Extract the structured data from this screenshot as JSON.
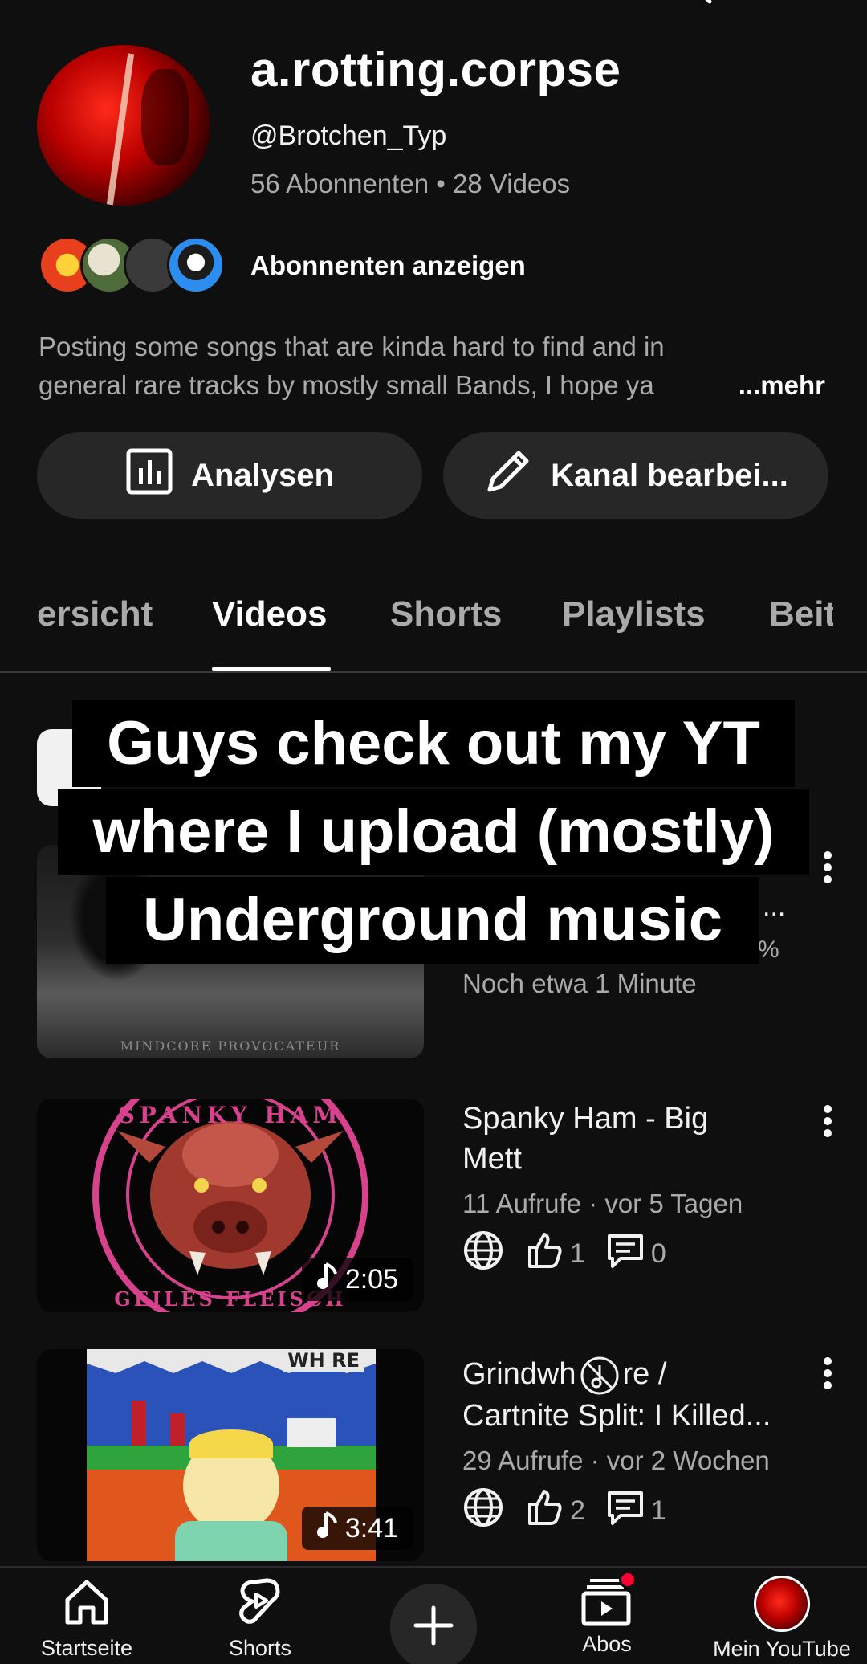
{
  "channel": {
    "name": "a.rotting.corpse",
    "handle": "@Brotchen_Typ",
    "meta": "56 Abonnenten • 28 Videos",
    "subscribers_link": "Abonnenten anzeigen",
    "description_line1": "Posting some songs that are kinda hard to find and in",
    "description_line2": "general rare tracks by mostly small Bands, I hope ya",
    "more_label": "...mehr"
  },
  "buttons": {
    "analytics": "Analysen",
    "edit_channel": "Kanal bearbei..."
  },
  "tabs": [
    "ersicht",
    "Videos",
    "Shorts",
    "Playlists",
    "Beit"
  ],
  "caption": {
    "line1": "Guys check out my YT",
    "line2": "where I upload (mostly)",
    "line3": "Underground music"
  },
  "videos": [
    {
      "thumb_text": "MINDCORE PROVOCATEUR",
      "title_partial": "...",
      "meta": "Noch etwa 1 Minute",
      "percent": "%"
    },
    {
      "title": "Spanky Ham - Big Mett",
      "title_line1": "Spanky Ham - Big",
      "title_line2": "Mett",
      "meta": "11 Aufrufe · vor 5 Tagen",
      "likes": "1",
      "comments": "0",
      "duration": "2:05",
      "thumb_text_top": "SPANKY HAM",
      "thumb_text_bottom": "GEILES FLEISCH"
    },
    {
      "title_line1": "Grindwh",
      "title_line1_end": "re /",
      "title_line2": "Cartnite Split: I Killed...",
      "meta": "29 Aufrufe · vor 2 Wochen",
      "likes": "2",
      "comments": "1",
      "duration": "3:41",
      "thumb_text": "WH RE"
    }
  ],
  "bottom_nav": {
    "home": "Startseite",
    "shorts": "Shorts",
    "subscriptions": "Abos",
    "you": "Mein YouTube"
  },
  "colors": {
    "background": "#0f0f0f",
    "chip": "#272727",
    "secondary_text": "#aaaaaa",
    "notification": "#ff0033"
  }
}
